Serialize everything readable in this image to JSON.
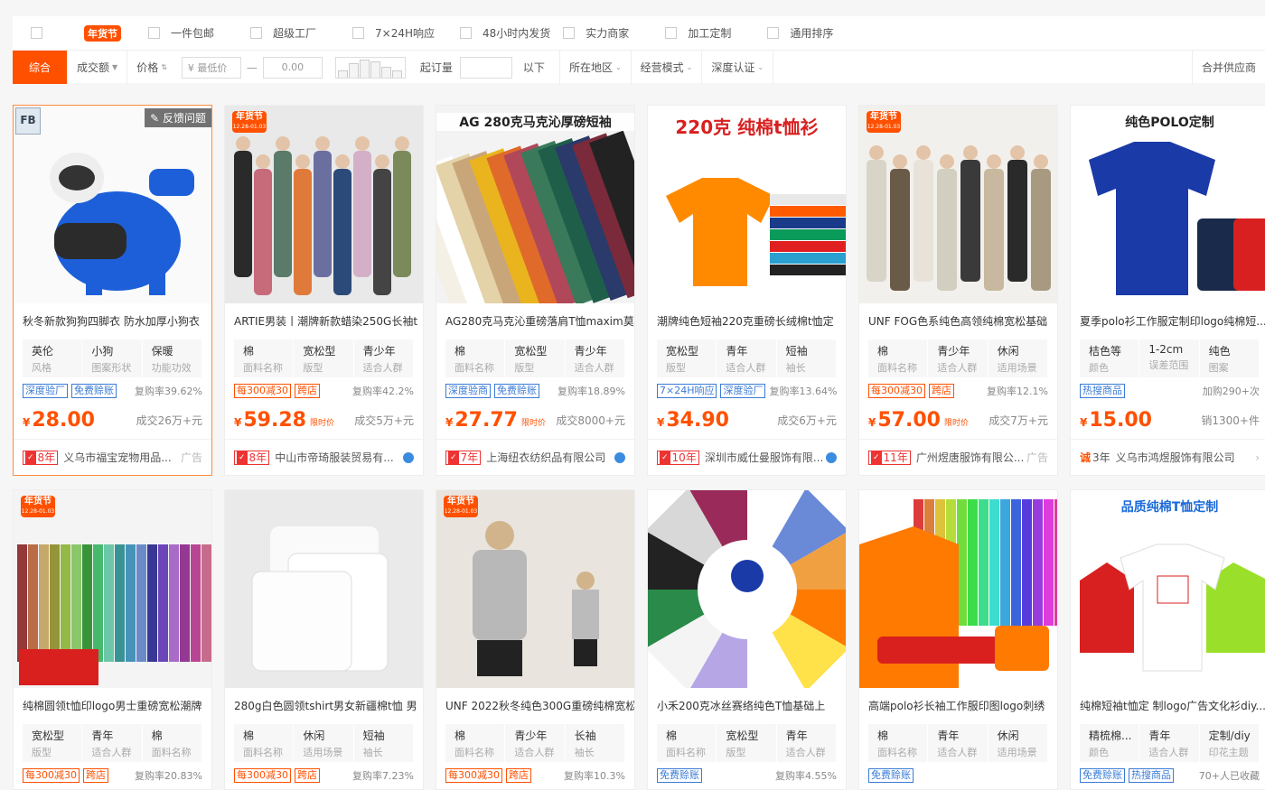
{
  "filters": {
    "checks": [
      "",
      "年货节",
      "一件包邮",
      "超级工厂",
      "7×24H响应",
      "48小时内发货",
      "实力商家",
      "加工定制",
      "通用排序"
    ]
  },
  "sort": {
    "tabs": [
      "综合",
      "成交额",
      "价格"
    ],
    "min_price": "¥ 最低价",
    "dash": "—",
    "max_price": "0.00",
    "moq_label": "起订量",
    "below": "以下",
    "region": "所在地区",
    "mode": "经营模式",
    "cert": "深度认证",
    "merge": "合并供应商"
  },
  "products": [
    {
      "title": "秋冬新款狗狗四脚衣 防水加厚小狗衣",
      "attrs": [
        [
          "英伦",
          "风格"
        ],
        [
          "小狗",
          "图案形状"
        ],
        [
          "保暖",
          "功能功效"
        ]
      ],
      "tags": [
        "深度验厂",
        "免费赊账"
      ],
      "tagcolors": [
        "blue",
        "blue"
      ],
      "rep": "复购率39.62%",
      "price": "28.00",
      "ltd": "",
      "sold": "成交26万+元",
      "years": "8年",
      "shop": "义乌市福宝宠物用品...",
      "end": "广告",
      "badge": "FB",
      "feedback": "反馈问题",
      "img": "dog"
    },
    {
      "title": "ARTIE男装丨潮牌新款蜡染250G长袖t",
      "attrs": [
        [
          "棉",
          "面料名称"
        ],
        [
          "宽松型",
          "版型"
        ],
        [
          "青少年",
          "适合人群"
        ]
      ],
      "tags": [
        "每300减30",
        "跨店"
      ],
      "tagcolors": [
        "red",
        "red"
      ],
      "rep": "复购率42.2%",
      "price": "59.28",
      "ltd": "限时价",
      "sold": "成交5万+元",
      "years": "8年",
      "shop": "中山市帝琦服装贸易有...",
      "end": "wang",
      "badge": "ny",
      "img": "group"
    },
    {
      "title": "AG280克马克沁重磅落肩T恤maxim莫",
      "attrs": [
        [
          "棉",
          "面料名称"
        ],
        [
          "宽松型",
          "版型"
        ],
        [
          "青少年",
          "适合人群"
        ]
      ],
      "tags": [
        "深度验商",
        "免费赊账"
      ],
      "tagcolors": [
        "blue",
        "blue"
      ],
      "rep": "复购率18.89%",
      "price": "27.77",
      "ltd": "限时价",
      "sold": "成交8000+元",
      "years": "7年",
      "shop": "上海纽衣纺织品有限公司",
      "end": "wang",
      "head": "AG 280克马克沁厚磅短袖",
      "img": "folded"
    },
    {
      "title": "潮牌纯色短袖220克重磅长绒棉t恤定",
      "attrs": [
        [
          "宽松型",
          "版型"
        ],
        [
          "青年",
          "适合人群"
        ],
        [
          "短袖",
          "袖长"
        ]
      ],
      "tags": [
        "7×24H响应",
        "深度验厂"
      ],
      "tagcolors": [
        "blue",
        "blue"
      ],
      "rep": "复购率13.64%",
      "price": "34.90",
      "ltd": "",
      "sold": "成交6万+元",
      "years": "10年",
      "shop": "深圳市威仕曼服饰有限...",
      "end": "wang",
      "head": "220克 纯棉t恤衫",
      "img": "orange"
    },
    {
      "title": "UNF FOG色系纯色高领纯棉宽松基础",
      "attrs": [
        [
          "棉",
          "面料名称"
        ],
        [
          "青少年",
          "适合人群"
        ],
        [
          "休闲",
          "适用场景"
        ]
      ],
      "tags": [
        "每300减30",
        "跨店"
      ],
      "tagcolors": [
        "red",
        "red"
      ],
      "rep": "复购率12.1%",
      "price": "57.00",
      "ltd": "限时价",
      "sold": "成交7万+元",
      "years": "11年",
      "shop": "广州煜唐服饰有限公...",
      "end": "广告",
      "badge": "ny",
      "img": "group2"
    },
    {
      "title": "夏季polo衫工作服定制印logo纯棉短...",
      "attrs": [
        [
          "桔色等",
          "颜色"
        ],
        [
          "1-2cm",
          "误差范围"
        ],
        [
          "纯色",
          "图案"
        ]
      ],
      "tags": [
        "热搜商品"
      ],
      "tagcolors": [
        "blue"
      ],
      "rep": "加购290+次",
      "price": "15.00",
      "ltd": "",
      "sold": "销1300+件",
      "years": "3年",
      "shop": "义乌市鸿煜服饰有限公司",
      "end": "arrow",
      "head": "纯色POLO定制",
      "img": "polo"
    },
    {
      "title": "纯棉圆领t恤印logo男士重磅宽松潮牌",
      "attrs": [
        [
          "宽松型",
          "版型"
        ],
        [
          "青年",
          "适合人群"
        ],
        [
          "棉",
          "面料名称"
        ]
      ],
      "tags": [
        "每300减30",
        "跨店"
      ],
      "tagcolors": [
        "red",
        "red"
      ],
      "rep": "复购率20.83%",
      "badge": "ny",
      "img": "rack"
    },
    {
      "title": "280g白色圆领tshirt男女新疆棉t恤 男",
      "attrs": [
        [
          "棉",
          "面料名称"
        ],
        [
          "休闲",
          "适用场景"
        ],
        [
          "短袖",
          "袖长"
        ]
      ],
      "tags": [
        "每300减30",
        "跨店"
      ],
      "tagcolors": [
        "red",
        "red"
      ],
      "rep": "复购率7.23%",
      "img": "white"
    },
    {
      "title": "UNF 2022秋冬纯色300G重磅纯棉宽松",
      "attrs": [
        [
          "棉",
          "面料名称"
        ],
        [
          "青少年",
          "适合人群"
        ],
        [
          "长袖",
          "袖长"
        ]
      ],
      "tags": [
        "每300减30",
        "跨店"
      ],
      "tagcolors": [
        "red",
        "red"
      ],
      "rep": "复购率10.3%",
      "badge": "ny",
      "img": "model"
    },
    {
      "title": "小禾200克冰丝赛络纯色T恤基础上",
      "attrs": [
        [
          "棉",
          "面料名称"
        ],
        [
          "宽松型",
          "版型"
        ],
        [
          "青年",
          "适合人群"
        ]
      ],
      "tags": [
        "免费赊账"
      ],
      "tagcolors": [
        "blue"
      ],
      "rep": "复购率4.55%",
      "img": "wheel"
    },
    {
      "title": "高端polo衫长袖工作服印图logo刺绣",
      "attrs": [
        [
          "棉",
          "面料名称"
        ],
        [
          "青年",
          "适合人群"
        ],
        [
          "休闲",
          "适用场景"
        ]
      ],
      "tags": [
        "免费赊账"
      ],
      "tagcolors": [
        "blue"
      ],
      "rep": "",
      "img": "orangepolo"
    },
    {
      "title": "纯棉短袖t恤定 制logo广告文化衫diy...",
      "attrs": [
        [
          "精梳棉...",
          "颜色"
        ],
        [
          "青年",
          "适合人群"
        ],
        [
          "定制/diy",
          "印花主题"
        ]
      ],
      "tags": [
        "免费赊账",
        "热搜商品"
      ],
      "tagcolors": [
        "blue",
        "blue"
      ],
      "rep": "70+人已收藏",
      "head": "品质纯棉T恤定制",
      "img": "shirts"
    }
  ]
}
